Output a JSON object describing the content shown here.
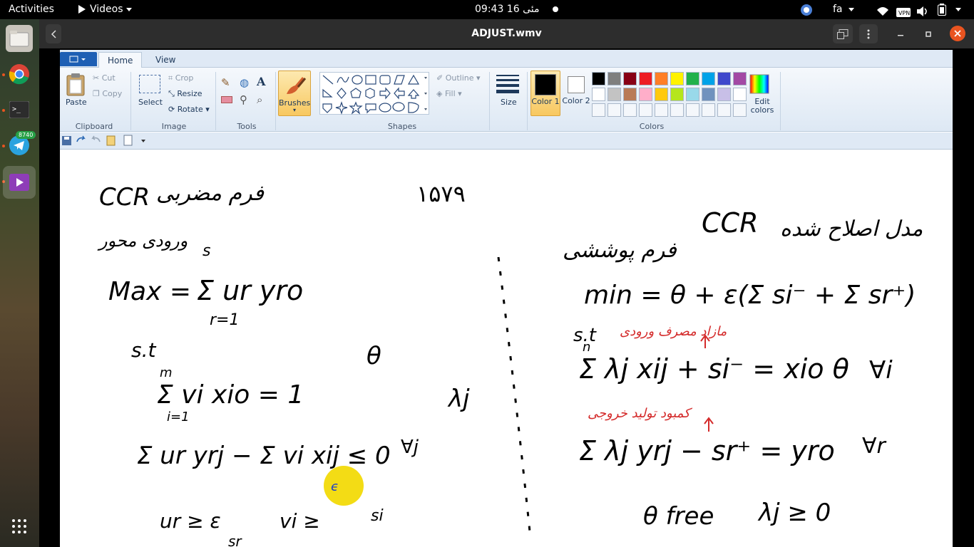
{
  "topbar": {
    "activities": "Activities",
    "app_menu": "Videos",
    "clock": "09:43  16 مئی",
    "language": "fa"
  },
  "dock": {
    "telegram_badge": "8740"
  },
  "player": {
    "title": "ADJUST.wmv"
  },
  "paint": {
    "tabs": [
      "Home",
      "View"
    ],
    "clipboard": {
      "paste": "Paste",
      "cut": "Cut",
      "copy": "Copy",
      "group": "Clipboard"
    },
    "image": {
      "select": "Select",
      "crop": "Crop",
      "resize": "Resize",
      "rotate": "Rotate",
      "group": "Image"
    },
    "tools": {
      "group": "Tools"
    },
    "brushes": "Brushes",
    "shapes": {
      "outline": "Outline",
      "fill": "Fill",
      "group": "Shapes"
    },
    "size": "Size",
    "color1": "Color 1",
    "color2": "Color 2",
    "edit_colors": "Edit colors",
    "colors_group": "Colors",
    "palette_row1": [
      "#000000",
      "#7f7f7f",
      "#880015",
      "#ed1c24",
      "#ff7f27",
      "#fff200",
      "#22b14c",
      "#00a2e8",
      "#3f48cc",
      "#a349a4"
    ],
    "palette_row2": [
      "#ffffff",
      "#c3c3c3",
      "#b97a57",
      "#ffaec9",
      "#ffc90e",
      "#b5e61d",
      "#99d9ea",
      "#7092be",
      "#c8bfe7",
      "#ffffff"
    ]
  },
  "notes": {
    "ccr_left": "CCR",
    "left_heading": "فرم مضربی",
    "number": "۱۵۷۹",
    "left_sub": "ورودی محور",
    "max": "Max =",
    "sum_ur": "Σ ur yro",
    "s_top": "s",
    "r_eq_1": "r=1",
    "st_left": "s.t",
    "m_idx": "m",
    "constraint1": "Σ vi xio = 1",
    "i_eq_1": "i=1",
    "theta_left": "θ",
    "constraint2": "Σ ur yrj − Σ vi xij ≤ 0",
    "lambda_left": "λj",
    "j_forall": "∀j",
    "nonneg": "ur ≥ ε",
    "vi_nonneg": "vi ≥",
    "sr_left": "sr",
    "si_left": "si",
    "ccr_right": "CCR",
    "right_heading": "مدل اصلاح شده",
    "right_sub": "فرم پوششی",
    "min": "min = θ + ε(Σ si⁻ + Σ sr⁺)",
    "st_right": "s.t",
    "red1": "مازاد مصرف ورودی",
    "constraint3": "Σ λj xij + si⁻ = xio θ",
    "forall_i": "∀i",
    "n_idx": "n",
    "red2": "کمبود تولید خروجی",
    "constraint4": "Σ λj yrj − sr⁺ = yro",
    "forall_r": "∀r",
    "theta_free": "θ free",
    "lambda_nonneg": "λj ≥ 0"
  }
}
